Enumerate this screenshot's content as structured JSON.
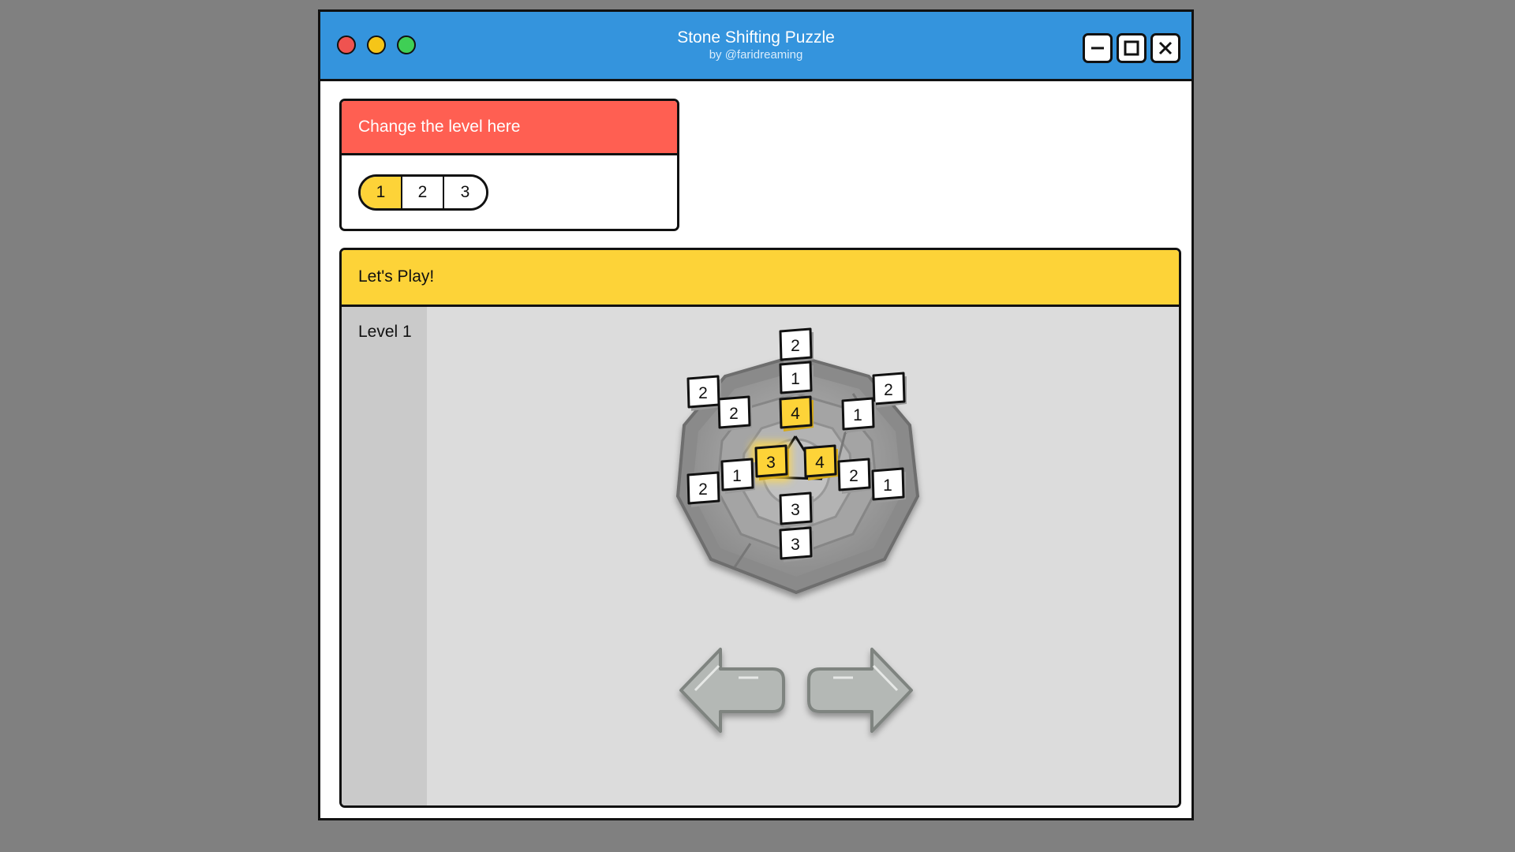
{
  "window": {
    "title": "Stone Shifting Puzzle",
    "subtitle": "by @faridreaming",
    "traffic_lights": [
      "#ef5350",
      "#f5c518",
      "#3fcf55"
    ],
    "controls": [
      "minimize-icon",
      "maximize-icon",
      "close-icon"
    ]
  },
  "level_card": {
    "heading": "Change the level here",
    "heading_color": "#ff5f52",
    "options": [
      "1",
      "2",
      "3"
    ],
    "selected": "1",
    "selected_color": "#fdd338"
  },
  "play_card": {
    "heading": "Let's Play!",
    "heading_color": "#fdd338",
    "level_label": "Level 1"
  },
  "board": {
    "stones": [
      {
        "value": "2",
        "highlight": false
      },
      {
        "value": "1",
        "highlight": false
      },
      {
        "value": "4",
        "highlight": true
      },
      {
        "value": "2",
        "highlight": false
      },
      {
        "value": "2",
        "highlight": false
      },
      {
        "value": "2",
        "highlight": false
      },
      {
        "value": "1",
        "highlight": false
      },
      {
        "value": "3",
        "highlight": true,
        "selected": true
      },
      {
        "value": "4",
        "highlight": true
      },
      {
        "value": "1",
        "highlight": false
      },
      {
        "value": "2",
        "highlight": false
      },
      {
        "value": "2",
        "highlight": false
      },
      {
        "value": "1",
        "highlight": false
      },
      {
        "value": "3",
        "highlight": false
      },
      {
        "value": "3",
        "highlight": false
      }
    ],
    "rotate_left_icon": "arrow-left-icon",
    "rotate_right_icon": "arrow-right-icon"
  }
}
